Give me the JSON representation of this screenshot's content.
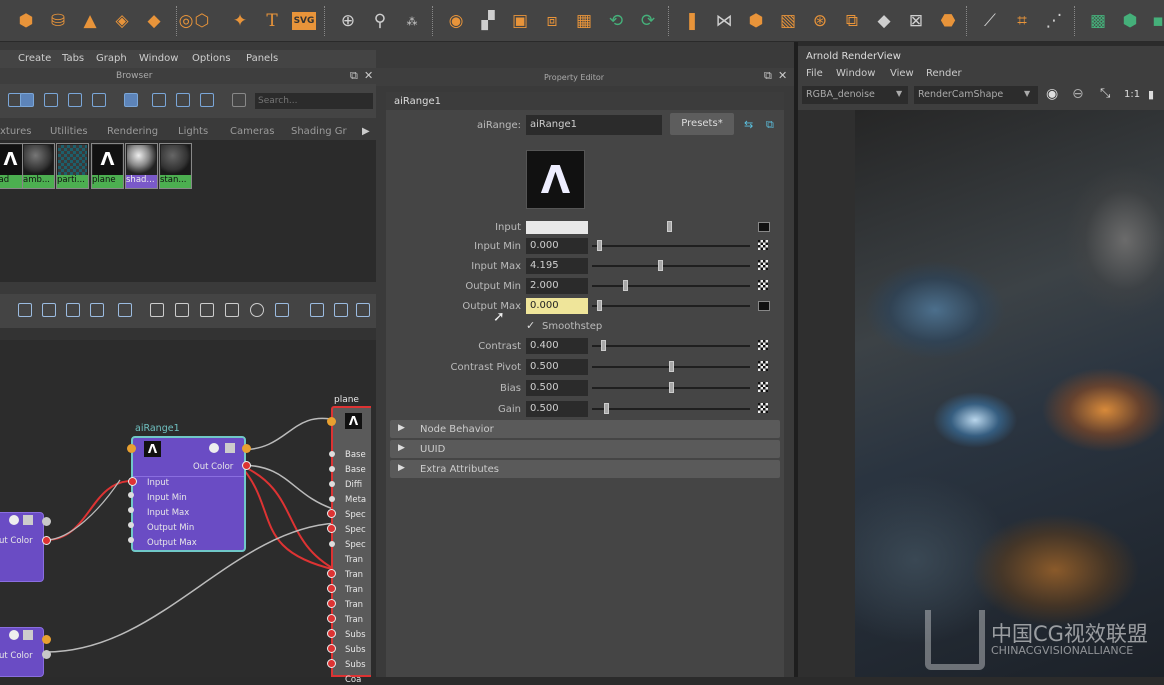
{
  "shelf": {
    "icons": [
      "sphere-icon",
      "cylinder-icon",
      "cone-icon",
      "torus-icon",
      "plane-icon",
      "disk-icon",
      "bevel-icon",
      "star-icon",
      "text-icon",
      "svg-icon",
      "transform-icon",
      "snap-icon",
      "grid-snap-icon",
      "move-tool-icon",
      "scale-tool-icon",
      "extrude-icon",
      "split-icon",
      "uv-icon",
      "duplicate-icon",
      "bend-icon",
      "flare-icon",
      "sine-icon",
      "squash-icon",
      "twist-icon",
      "wave-icon",
      "lattice-icon",
      "wrap-icon",
      "cluster-icon",
      "soft-mod-icon",
      "curve-tool-icon",
      "joint-icon",
      "ik-icon",
      "render-settings-icon",
      "hypershade-icon",
      "aov-icon"
    ]
  },
  "hypershade": {
    "menu": [
      "Create",
      "Tabs",
      "Graph",
      "Window",
      "Options",
      "Panels"
    ],
    "browser_title": "Browser",
    "search_placeholder": "Search...",
    "tabs": [
      "xtures",
      "Utilities",
      "Rendering",
      "Lights",
      "Cameras",
      "Shading Gr"
    ],
    "swatches": [
      {
        "label": "rad",
        "kind": "arnold"
      },
      {
        "label": "amb...",
        "kind": "sphere"
      },
      {
        "label": "parti...",
        "kind": "checker"
      },
      {
        "label": "plane",
        "kind": "arnold"
      },
      {
        "label": "shad...",
        "kind": "bright"
      },
      {
        "label": "stan...",
        "kind": "sphere"
      }
    ]
  },
  "graph": {
    "node_main": {
      "title": "aiRange1",
      "out": "Out Color",
      "attrs": [
        "Input",
        "Input Min",
        "Input Max",
        "Output Min",
        "Output Max"
      ]
    },
    "node_plane": {
      "title": "plane",
      "attrs": [
        "Base",
        "Base",
        "Diffi",
        "Meta",
        "Spec",
        "Spec",
        "Spec",
        "Tran",
        "Tran",
        "Tran",
        "Tran",
        "Tran",
        "Subs",
        "Subs",
        "Subs",
        "Coa"
      ]
    },
    "node_left1": {
      "out": "ut Color"
    },
    "node_left2": {
      "out": "ut Color"
    }
  },
  "property_editor": {
    "panel_title": "Property Editor",
    "tab": "aiRange1",
    "name_label": "aiRange:",
    "name_value": "aiRange1",
    "presets": "Presets*",
    "rows": [
      {
        "label": "Input Min",
        "value": "0.000",
        "pos": 0.03
      },
      {
        "label": "Input Max",
        "value": "4.195",
        "pos": 0.43
      },
      {
        "label": "Output Min",
        "value": "2.000",
        "pos": 0.2
      },
      {
        "label": "Output Max",
        "value": "0.000",
        "pos": 0.03
      },
      {
        "label": "Contrast",
        "value": "0.400",
        "pos": 0.06
      },
      {
        "label": "Contrast Pivot",
        "value": "0.500",
        "pos": 0.5
      },
      {
        "label": "Bias",
        "value": "0.500",
        "pos": 0.5
      },
      {
        "label": "Gain",
        "value": "0.500",
        "pos": 0.08
      }
    ],
    "input_label": "Input",
    "smoothstep": "Smoothstep",
    "sections": [
      "Node Behavior",
      "UUID",
      "Extra Attributes"
    ]
  },
  "renderview": {
    "title": "Arnold RenderView",
    "menu": [
      "File",
      "Window",
      "View",
      "Render"
    ],
    "aov": "RGBA_denoise",
    "camera": "RenderCamShape",
    "ratio": "1:1"
  },
  "watermark": {
    "cn": "中国CG视效联盟",
    "en": "CHINACGVISIONALLIANCE"
  }
}
